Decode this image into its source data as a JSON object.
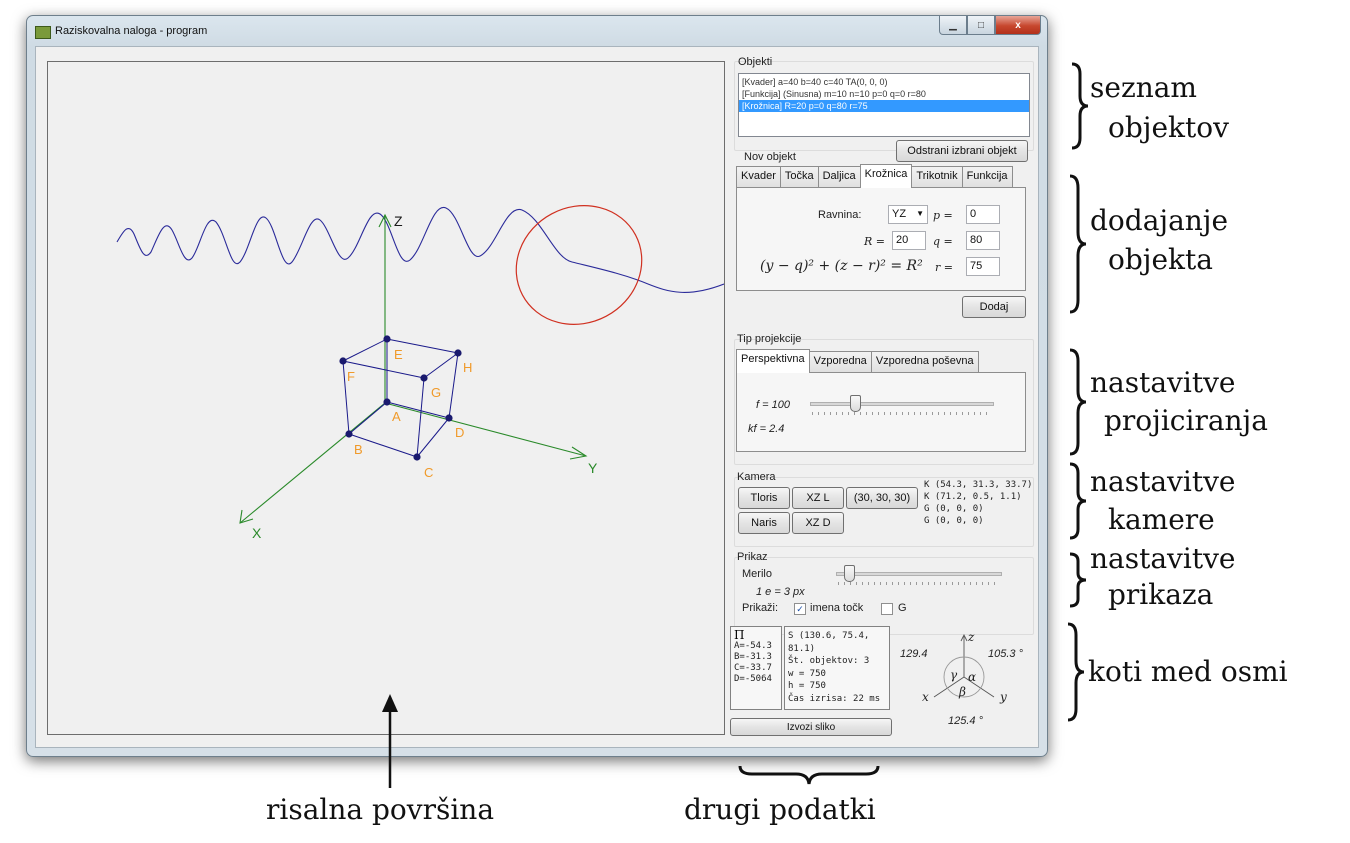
{
  "window": {
    "title": "Raziskovalna naloga - program",
    "buttons": {
      "minimize": "▁",
      "maximize": "□",
      "close": "x"
    }
  },
  "canvas": {
    "axes": {
      "z": "Z",
      "y": "Y",
      "x": "X"
    },
    "points": {
      "A": "A",
      "B": "B",
      "C": "C",
      "D": "D",
      "E": "E",
      "F": "F",
      "G": "G",
      "H": "H"
    },
    "colors": {
      "axis": "#2a8a2a",
      "cube": "#1a1a8a",
      "labels": "#f09a2a",
      "sine": "#2b2b9a",
      "circle": "#d03020"
    }
  },
  "objekti": {
    "label": "Objekti",
    "items": [
      "[Kvader] a=40 b=40 c=40 TA(0, 0, 0)",
      "[Funkcija] (Sinusna) m=10 n=10 p=0 q=0 r=80",
      "[Krožnica] R=20 p=0 q=80 r=75"
    ],
    "selected_index": 2,
    "remove_button": "Odstrani izbrani objekt"
  },
  "nov_objekt": {
    "label": "Nov objekt",
    "tabs": [
      "Kvader",
      "Točka",
      "Daljica",
      "Krožnica",
      "Trikotnik",
      "Funkcija"
    ],
    "active_tab": 3,
    "ravnina_label": "Ravnina:",
    "ravnina_value": "YZ",
    "p_label": "p =",
    "p_value": "0",
    "R_label": "R =",
    "R_value": "20",
    "q_label": "q =",
    "q_value": "80",
    "r_label": "r =",
    "r_value": "75",
    "formula": "(y − q)² + (z − r)² = R²",
    "add_button": "Dodaj"
  },
  "projekcija": {
    "label": "Tip projekcije",
    "tabs": [
      "Perspektivna",
      "Vzporedna",
      "Vzporedna poševna"
    ],
    "active_tab": 0,
    "f_label": "f = 100",
    "kf_label": "kf = 2.4",
    "slider_position": 0.23
  },
  "kamera": {
    "label": "Kamera",
    "buttons": [
      "Tloris",
      "XZ L",
      "(30, 30, 30)",
      "Naris",
      "XZ D"
    ],
    "info": [
      "K (54.3, 31.3, 33.7)",
      "K (71.2, 0.5, 1.1)",
      "G (0, 0, 0)",
      "G (0, 0, 0)"
    ]
  },
  "prikaz": {
    "label": "Prikaz",
    "merilo_label": "Merilo",
    "scale_label": "1 e = 3 px",
    "slider_position": 0.05,
    "prikazi_label": "Prikaži:",
    "imena_tock_label": "imena točk",
    "imena_tock_checked": true,
    "g_label": "G",
    "g_checked": false
  },
  "stats": {
    "plane": [
      "Π",
      "A=-54.3",
      "B=-31.3",
      "C=-33.7",
      "D=-5064"
    ],
    "info": [
      "S (130.6, 75.4, 81.1)",
      "Št. objektov: 3",
      "w = 750",
      "h = 750",
      "Čas izrisa: 22 ms"
    ],
    "export_button": "Izvozi sliko"
  },
  "angles": {
    "top_left": "129.4",
    "top_right": "105.3 °",
    "bottom": "125.4 °",
    "z": "z",
    "x": "x",
    "y": "y",
    "gamma": "γ",
    "alpha": "α",
    "beta": "β"
  },
  "annotations": {
    "seznam": [
      "seznam",
      "objektov"
    ],
    "dodajanje": [
      "dodajanje",
      "objekta"
    ],
    "projiciranje": [
      "nastavitve",
      "projiciranja"
    ],
    "kamere": [
      "nastavitve",
      "kamere"
    ],
    "prikaza": [
      "nastavitve",
      "prikaza"
    ],
    "koti": "koti med osmi",
    "risalna": "risalna površina",
    "drugi": "drugi podatki"
  }
}
